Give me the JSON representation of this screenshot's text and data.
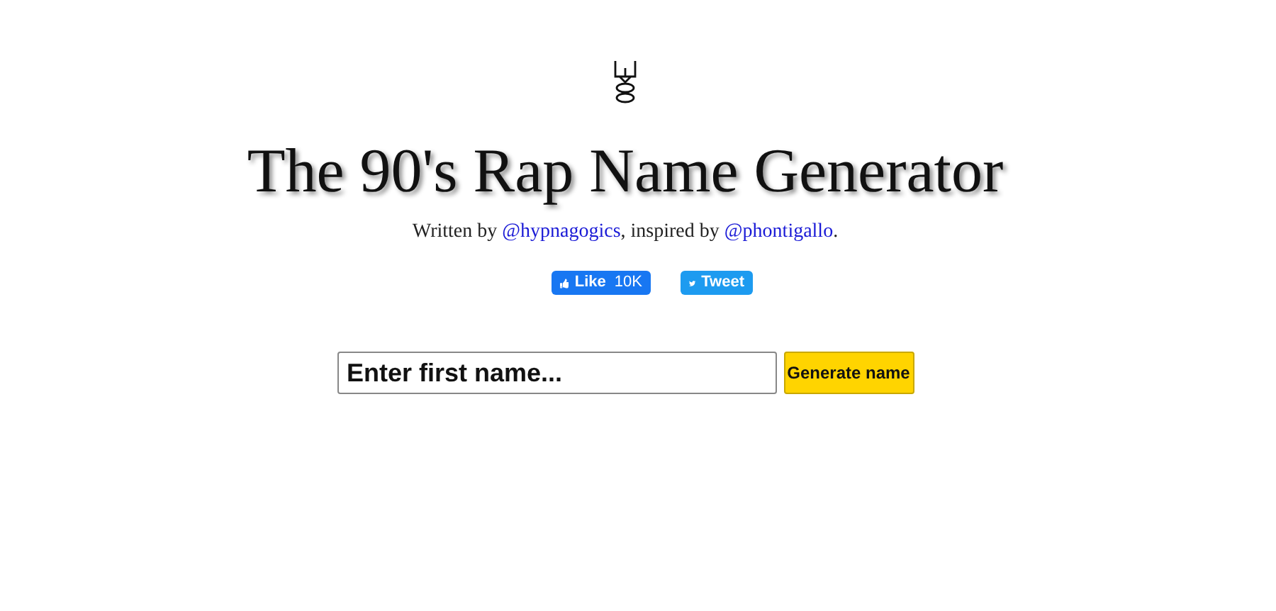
{
  "title": "The 90's Rap Name Generator",
  "byline": {
    "before": "Written by ",
    "link_1": "@hypnagogics",
    "middle": ", inspired by ",
    "link_2": "@phontigallo",
    "after": "."
  },
  "social": {
    "like": {
      "label": "Like",
      "count": "10K"
    },
    "tweet": {
      "label": "Tweet"
    }
  },
  "form": {
    "placeholder": "Enter first name...",
    "button": "Generate name"
  }
}
